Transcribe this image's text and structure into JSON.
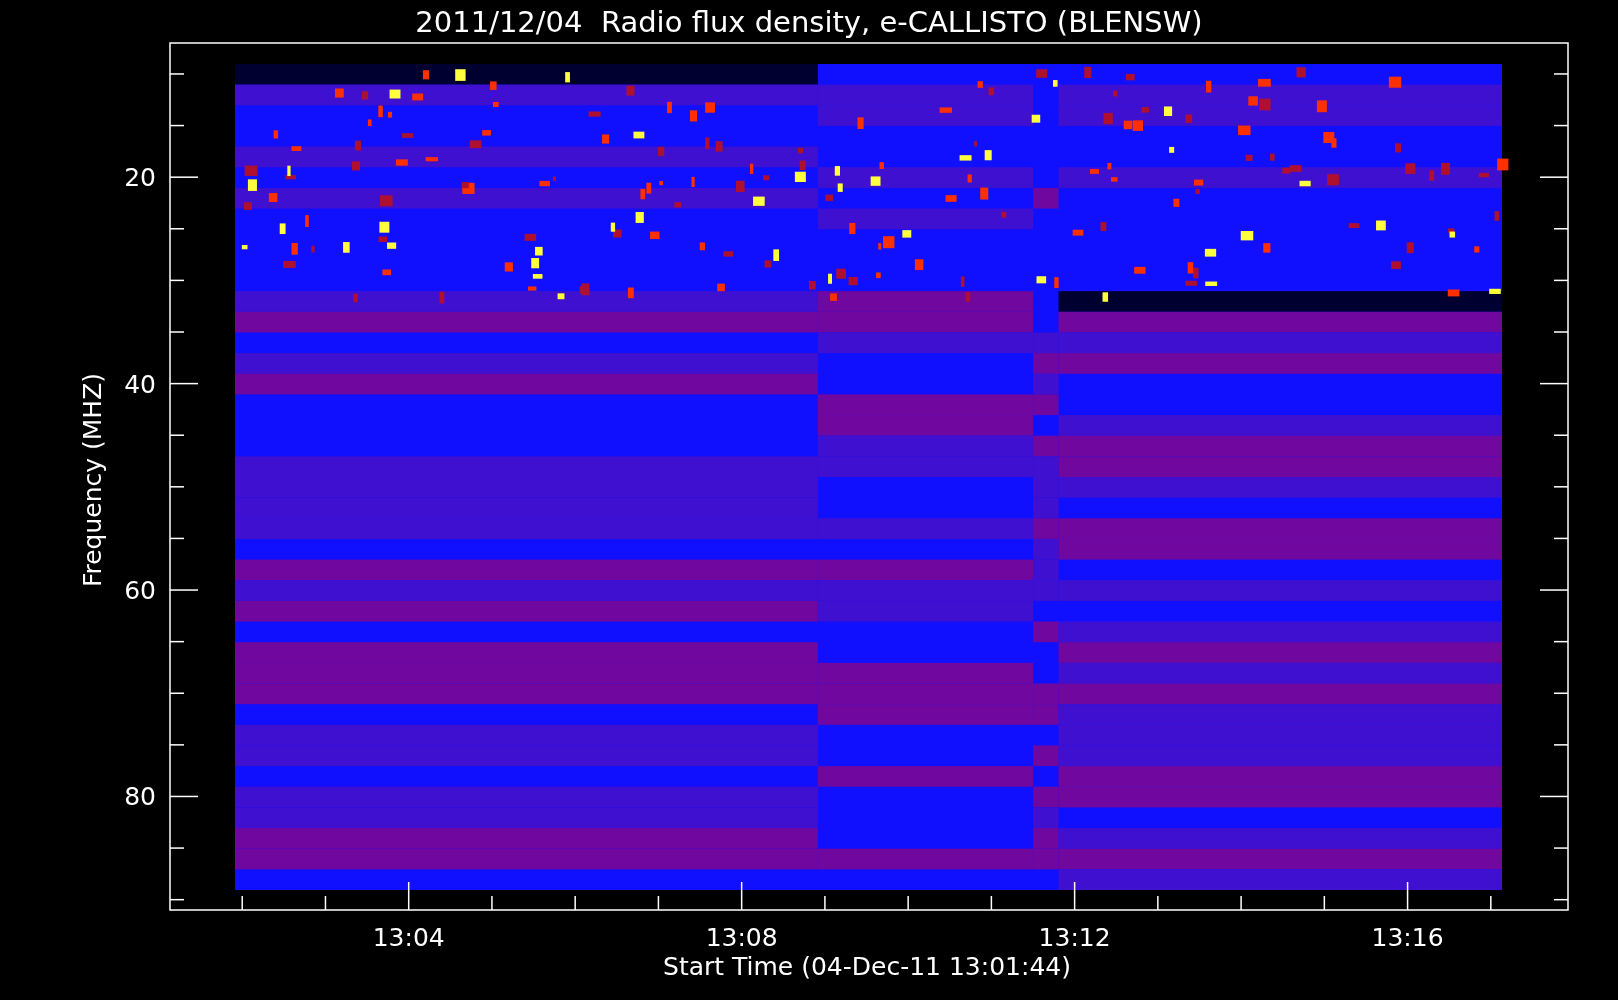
{
  "title": "2011/12/04  Radio flux density, e-CALLISTO (BLENSW)",
  "y_axis": {
    "label": "Frequency (MHZ)",
    "ticks": [
      "20",
      "40",
      "60",
      "80"
    ]
  },
  "x_axis": {
    "label": "Start Time (04-Dec-11 13:01:44)",
    "ticks": [
      "13:04",
      "13:08",
      "13:12",
      "13:16"
    ]
  }
}
